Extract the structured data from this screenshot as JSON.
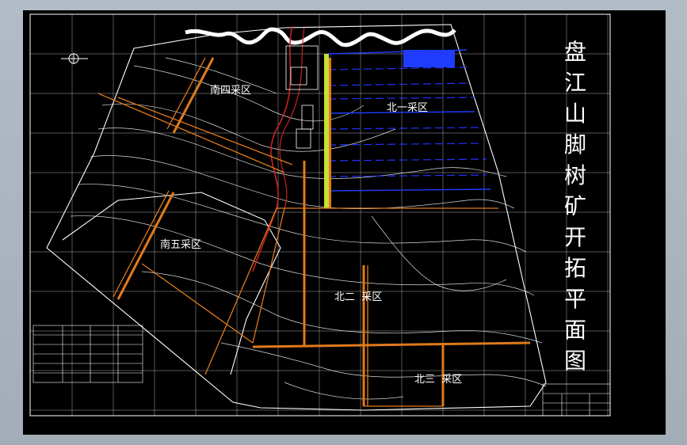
{
  "drawing": {
    "title_chars": [
      "盘",
      "江",
      "山",
      "脚",
      "树",
      "矿",
      "开",
      "拓",
      "平",
      "面",
      "图"
    ],
    "zones": [
      {
        "id": "south4",
        "label": "南四采区"
      },
      {
        "id": "north1",
        "label": "北一采区"
      },
      {
        "id": "south5",
        "label": "南五采区"
      },
      {
        "id": "north2",
        "label": "北二  采区"
      },
      {
        "id": "north3",
        "label": "北三  采区"
      }
    ],
    "colors": {
      "canvas_bg": "#000000",
      "lines": "#ffffff",
      "roadway": "#e07a1c",
      "north1_workings": "#2233ff",
      "shaft_highlight": "#c8e030",
      "river": "#ffffff"
    },
    "icons": [
      "north-arrow-icon"
    ]
  }
}
